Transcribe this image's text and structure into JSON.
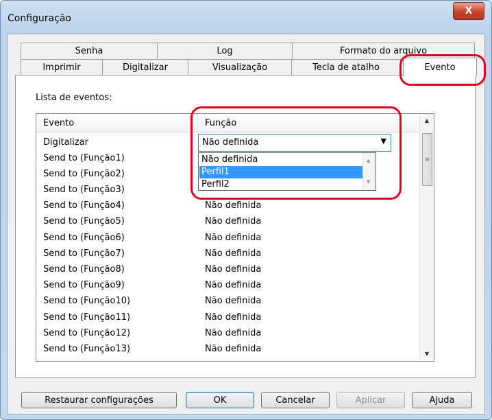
{
  "window": {
    "title": "Configuração",
    "close_glyph": "X"
  },
  "tabs": {
    "row_back": [
      "Senha",
      "Log",
      "Formato do arquivo"
    ],
    "row_front": [
      "Imprimir",
      "Digitalizar",
      "Visualização",
      "Tecla de atalho",
      "Evento"
    ],
    "active": "Evento"
  },
  "events": {
    "list_label": "Lista de eventos:",
    "headers": {
      "event": "Evento",
      "function": "Função"
    },
    "rows": [
      {
        "event": "Digitalizar",
        "function": "Não definida"
      },
      {
        "event": "Send to (Função1)",
        "function": ""
      },
      {
        "event": "Send to (Função2)",
        "function": ""
      },
      {
        "event": "Send to (Função3)",
        "function": ""
      },
      {
        "event": "Send to (Função4)",
        "function": "Não definida"
      },
      {
        "event": "Send to (Função5)",
        "function": "Não definida"
      },
      {
        "event": "Send to (Função6)",
        "function": "Não definida"
      },
      {
        "event": "Send to (Função7)",
        "function": "Não definida"
      },
      {
        "event": "Send to (Função8)",
        "function": "Não definida"
      },
      {
        "event": "Send to (Função9)",
        "function": "Não definida"
      },
      {
        "event": "Send to (Função10)",
        "function": "Não definida"
      },
      {
        "event": "Send to (Função11)",
        "function": "Não definida"
      },
      {
        "event": "Send to (Função12)",
        "function": "Não definida"
      },
      {
        "event": "Send to (Função13)",
        "function": "Não definida"
      }
    ]
  },
  "combo": {
    "value": "Não definida",
    "options": [
      "Não definida",
      "Perfil1",
      "Perfil2"
    ],
    "selected": "Perfil1"
  },
  "buttons": {
    "restore": "Restaurar configurações",
    "ok": "OK",
    "cancel": "Cancelar",
    "apply": "Aplicar",
    "help": "Ajuda"
  },
  "colors": {
    "highlight": "#e2001a",
    "selection": "#3399ff",
    "close_button": "#c9412b"
  }
}
